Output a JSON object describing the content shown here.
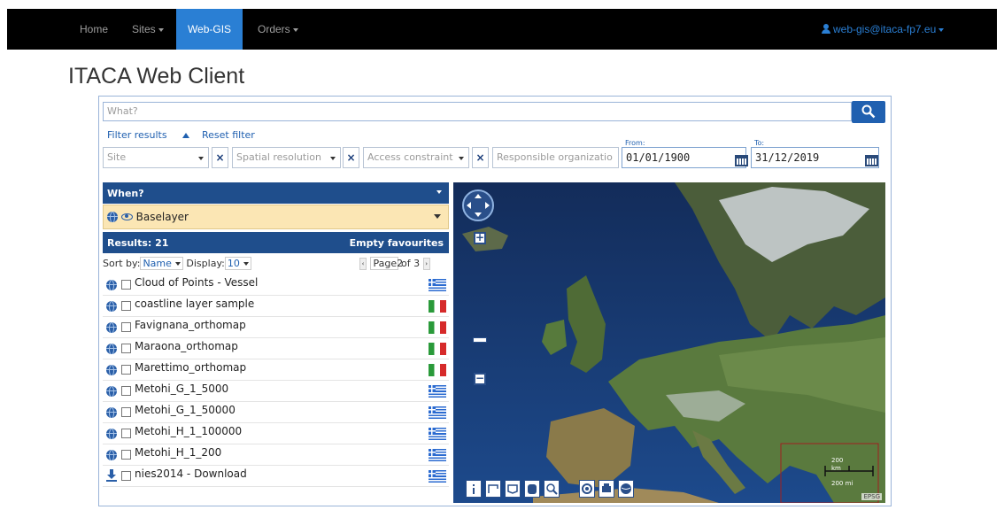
{
  "navbar": {
    "items": [
      {
        "label": "Home"
      },
      {
        "label": "Sites"
      },
      {
        "label": "Web-GIS"
      },
      {
        "label": "Orders"
      }
    ],
    "user": "web-gis@itaca-fp7.eu",
    "active_color": "#2a7fd4"
  },
  "page_title": "ITACA Web Client",
  "search": {
    "placeholder": "What?"
  },
  "filters": {
    "filter_results": "Filter results",
    "reset_filter": "Reset filter",
    "site": "Site",
    "spatial_resolution": "Spatial resolution",
    "access_constraint": "Access constraint",
    "responsible_org": "Responsible organizatio",
    "from_label": "From:",
    "from_value": "01/01/1900",
    "to_label": "To:",
    "to_value": "31/12/2019",
    "x": "×"
  },
  "panel": {
    "when": "When?",
    "baselayer": "Baselayer",
    "results": "Results: 21",
    "empty_favourites": "Empty favourites",
    "sort_by": "Sort by:",
    "sort_value": "Name",
    "display": "Display:",
    "display_value": "10",
    "page_label": "Page",
    "page_value": "2",
    "page_of": "of 3",
    "prev": "‹",
    "next": "›"
  },
  "results": [
    {
      "name": "Cloud of Points - Vessel",
      "flag": "gr",
      "icon": "globe-icon"
    },
    {
      "name": "coastline layer sample",
      "flag": "it",
      "icon": "globe-icon"
    },
    {
      "name": "Favignana_orthomap",
      "flag": "it",
      "icon": "globe-icon"
    },
    {
      "name": "Maraona_orthomap",
      "flag": "it",
      "icon": "globe-icon"
    },
    {
      "name": "Marettimo_orthomap",
      "flag": "it",
      "icon": "globe-icon"
    },
    {
      "name": "Metohi_G_1_5000",
      "flag": "gr",
      "icon": "globe-icon"
    },
    {
      "name": "Metohi_G_1_50000",
      "flag": "gr",
      "icon": "globe-icon"
    },
    {
      "name": "Metohi_H_1_100000",
      "flag": "gr",
      "icon": "globe-icon"
    },
    {
      "name": "Metohi_H_1_200",
      "flag": "gr",
      "icon": "globe-icon"
    },
    {
      "name": "nies2014 - Download",
      "flag": "gr",
      "icon": "download-icon"
    }
  ],
  "map": {
    "scale_top": "200",
    "scale_mid": "km",
    "scale_bottom": "200 mi",
    "epsg": "EPSG"
  }
}
